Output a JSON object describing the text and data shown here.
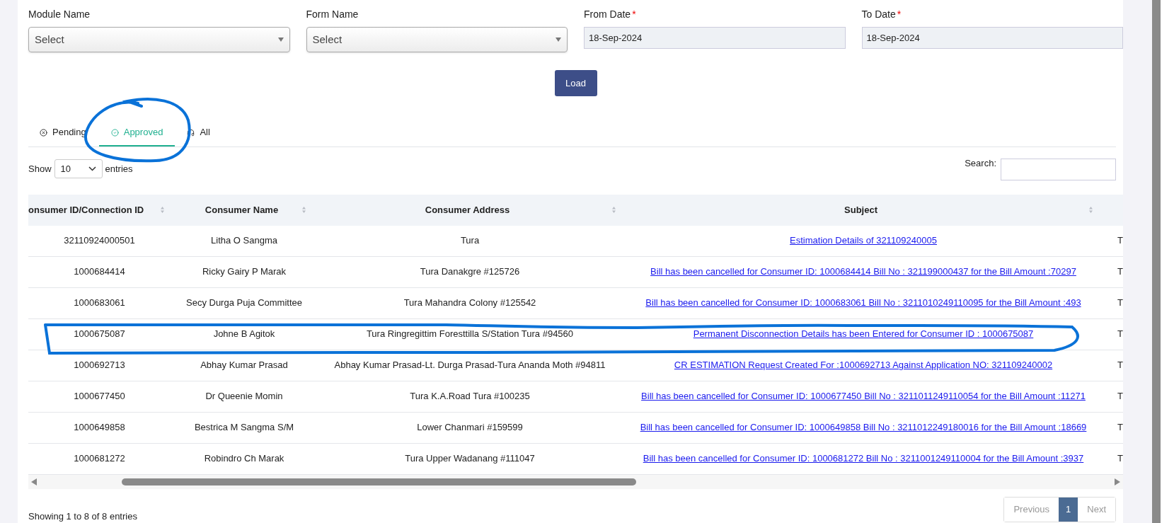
{
  "filters": [
    {
      "kind": "select",
      "label": "Module Name",
      "required": false,
      "value": "Select"
    },
    {
      "kind": "select",
      "label": "Form Name",
      "required": false,
      "value": "Select"
    },
    {
      "kind": "date",
      "label": "From Date",
      "required": true,
      "value": "18-Sep-2024"
    },
    {
      "kind": "date",
      "label": "To Date",
      "required": true,
      "value": "18-Sep-2024"
    }
  ],
  "required_mark": "*",
  "load_button": "Load",
  "tabs": [
    {
      "label": "Pending",
      "selected": false
    },
    {
      "label": "Approved",
      "selected": true
    },
    {
      "label": "All",
      "selected": false
    }
  ],
  "length": {
    "label": "Show",
    "value": "10",
    "suffix": "entries"
  },
  "search": {
    "label": "Search:"
  },
  "table": {
    "columns": [
      {
        "label": "onsumer ID/Connection ID",
        "sortable": true
      },
      {
        "label": "Consumer Name",
        "sortable": true
      },
      {
        "label": "Consumer Address",
        "sortable": true
      },
      {
        "label": "Subject",
        "sortable": true
      }
    ],
    "rows": [
      {
        "id": "32110924000501",
        "name": "Litha O Sangma",
        "address": "Tura",
        "subject": "Estimation Details of 321109240005",
        "column_5": "T"
      },
      {
        "id": "1000684414",
        "name": "Ricky Gairy P Marak",
        "address": "Tura Danakgre #125726",
        "subject": "Bill has been cancelled for Consumer ID: 1000684414 Bill No : 321199000437 for the Bill Amount :70297",
        "column_5": "T"
      },
      {
        "id": "1000683061",
        "name": "Secy Durga Puja Committee",
        "address": "Tura Mahandra Colony #125542",
        "subject": "Bill has been cancelled for Consumer ID: 1000683061 Bill No : 3211010249110095 for the Bill Amount :493",
        "column_5": "T"
      },
      {
        "id": "1000675087",
        "name": "Johne B Agitok",
        "address": "Tura Ringregittim Foresttilla S/Station Tura #94560",
        "subject": "Permanent Disconnection Details has been Entered for Consumer ID : 1000675087",
        "column_5": "T"
      },
      {
        "id": "1000692713",
        "name": "Abhay Kumar Prasad",
        "address": "Abhay Kumar Prasad-Lt. Durga Prasad-Tura Ananda Moth #94811",
        "subject": "CR ESTIMATION Request Created For :1000692713 Against Application NO: 321109240002",
        "column_5": "T"
      },
      {
        "id": "1000677450",
        "name": "Dr Queenie Momin",
        "address": "Tura K.A.Road Tura #100235",
        "subject": "Bill has been cancelled for Consumer ID: 1000677450 Bill No : 3211011249110054 for the Bill Amount :11271",
        "column_5": "T"
      },
      {
        "id": "1000649858",
        "name": "Bestrica M Sangma S/M",
        "address": "Lower Chanmari #159599",
        "subject": "Bill has been cancelled for Consumer ID: 1000649858 Bill No : 3211012249180016 for the Bill Amount :18669",
        "column_5": "T"
      },
      {
        "id": "1000681272",
        "name": "Robindro Ch Marak",
        "address": "Tura Upper Wadanang #111047",
        "subject": "Bill has been cancelled for Consumer ID: 1000681272 Bill No : 3211001249110004 for the Bill Amount :3937",
        "column_5": "T"
      }
    ]
  },
  "info": "Showing 1 to 8 of 8 entries",
  "pagination": [
    {
      "label": "Previous",
      "kind": "nav",
      "disabled": true,
      "selected": false
    },
    {
      "label": "1",
      "kind": "page",
      "disabled": false,
      "selected": true
    },
    {
      "label": "Next",
      "kind": "nav",
      "disabled": true,
      "selected": false
    }
  ]
}
